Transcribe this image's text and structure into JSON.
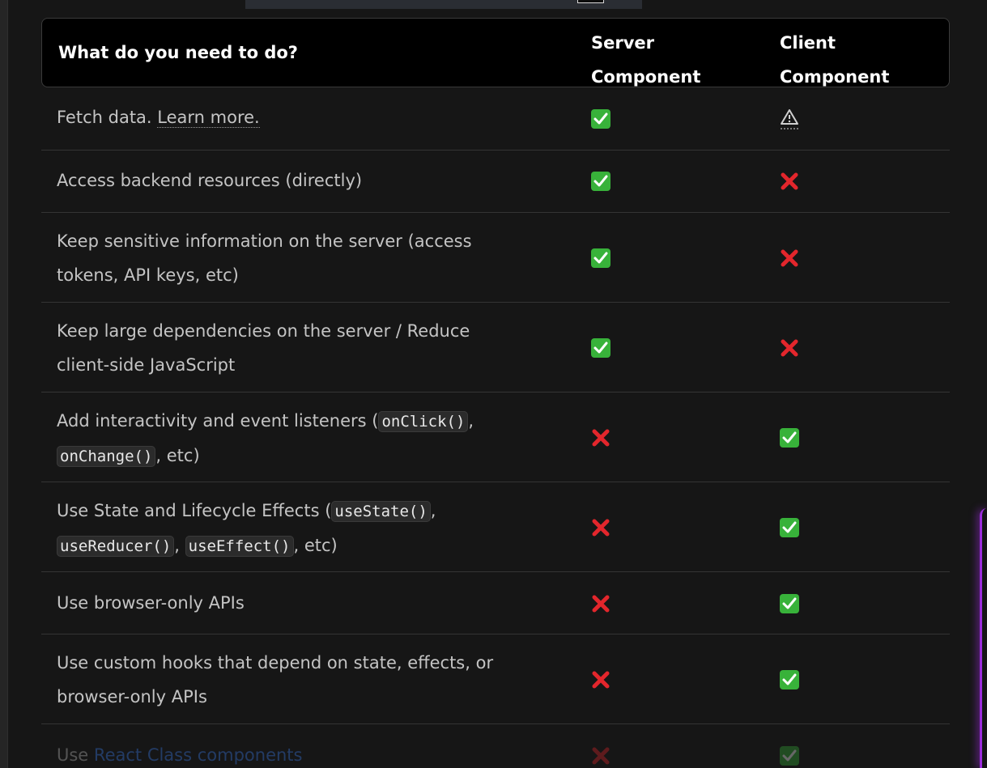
{
  "header": {
    "task_col": "What do you need to do?",
    "server_col_line1": "Server",
    "server_col_line2": "Component",
    "client_col_line1": "Client",
    "client_col_line2": "Component"
  },
  "rows": [
    {
      "text": "Fetch data.",
      "link": "Learn more.",
      "server": "check",
      "client": "warning"
    },
    {
      "text": "Access backend resources (directly)",
      "server": "check",
      "client": "cross"
    },
    {
      "line1": "Keep sensitive information on the server (access",
      "line2": "tokens, API keys, etc)",
      "server": "check",
      "client": "cross"
    },
    {
      "line1": "Keep large dependencies on the server / Reduce",
      "line2": "client-side JavaScript",
      "server": "check",
      "client": "cross"
    },
    {
      "prefix": "Add interactivity and event listeners (",
      "code1": "onClick()",
      "sep1": ",",
      "code2": "onChange()",
      "suffix": ", etc)",
      "server": "cross",
      "client": "check"
    },
    {
      "prefix": "Use State and Lifecycle Effects (",
      "code1": "useState()",
      "sep1": ",",
      "code2": "useReducer()",
      "sep2": ",",
      "code3": "useEffect()",
      "suffix": ", etc)",
      "server": "cross",
      "client": "check"
    },
    {
      "text": "Use browser-only APIs",
      "server": "cross",
      "client": "check"
    },
    {
      "line1": "Use custom hooks that depend on state, effects, or",
      "line2": "browser-only APIs",
      "server": "cross",
      "client": "check"
    },
    {
      "prefix": "Use ",
      "link": "React Class components",
      "server": "cross",
      "client": "check"
    }
  ],
  "colors": {
    "check": "#38b23a",
    "cross": "#e3262c",
    "link_blue": "#3b82f6",
    "accent_purple": "#9b2ddb"
  }
}
